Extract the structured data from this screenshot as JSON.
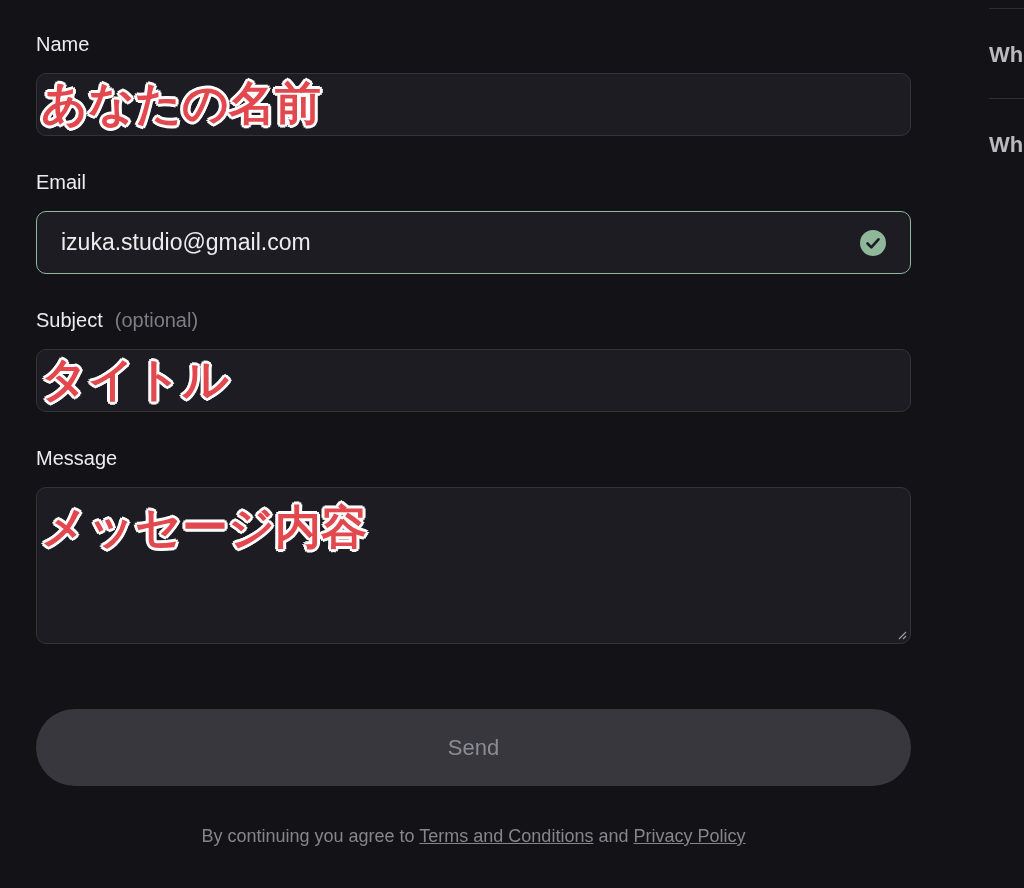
{
  "form": {
    "fields": [
      {
        "label": "Name",
        "kind": "text",
        "annotation": "あなたの名前"
      },
      {
        "label": "Email",
        "kind": "text",
        "value": "izuka.studio@gmail.com",
        "valid": true
      },
      {
        "label": "Subject",
        "hint": "(optional)",
        "kind": "text",
        "annotation": "タイトル"
      },
      {
        "label": "Message",
        "kind": "textarea",
        "annotation": "メッセージ内容"
      }
    ],
    "send_button": {
      "label": "Send",
      "disabled": true
    },
    "footer": {
      "text": "By continuing you agree to",
      "link_1": "Terms and Conditions",
      "joiner": "and",
      "link_2": "Privacy Policy"
    }
  },
  "sidebar": {
    "items": [
      "Wh",
      "Wh"
    ]
  }
}
